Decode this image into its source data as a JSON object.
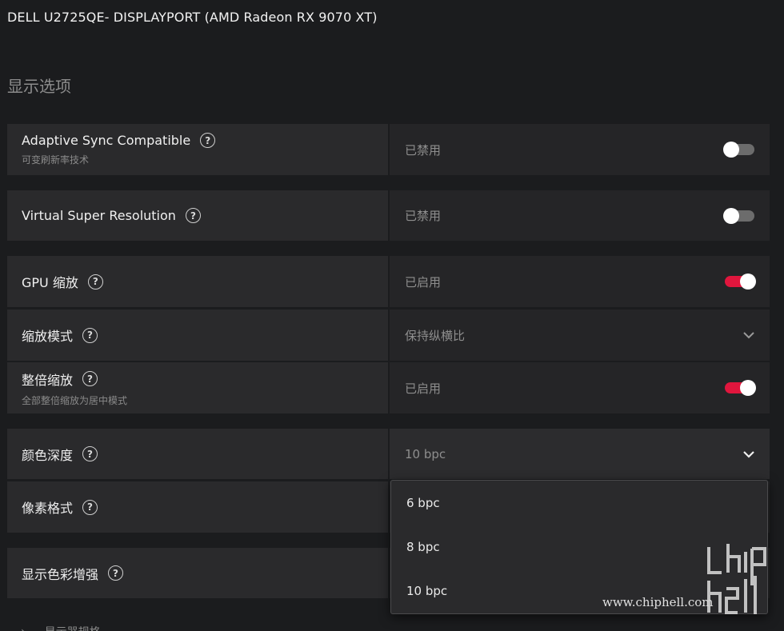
{
  "header": {
    "title": "DELL U2725QE- DISPLAYPORT (AMD Radeon RX 9070 XT)"
  },
  "section": {
    "title": "显示选项"
  },
  "settings": {
    "adaptive_sync": {
      "label": "Adaptive Sync Compatible",
      "sub": "可变刷新率技术",
      "value": "已禁用",
      "state": "off"
    },
    "vsr": {
      "label": "Virtual Super Resolution",
      "value": "已禁用",
      "state": "off"
    },
    "gpu_scaling": {
      "label": "GPU 缩放",
      "value": "已启用",
      "state": "on"
    },
    "scaling_mode": {
      "label": "缩放模式",
      "value": "保持纵横比"
    },
    "integer_scaling": {
      "label": "整倍缩放",
      "sub": "全部整倍缩放为居中模式",
      "value": "已启用",
      "state": "on"
    },
    "color_depth": {
      "label": "颜色深度",
      "value": "10 bpc"
    },
    "pixel_format": {
      "label": "像素格式"
    },
    "color_enhance": {
      "label": "显示色彩增强"
    }
  },
  "color_depth_dropdown": {
    "options": [
      "6 bpc",
      "8 bpc",
      "10 bpc"
    ]
  },
  "footer": {
    "cutoff_text": "显示器规格"
  },
  "watermark": {
    "text": "www.chiphell.com"
  },
  "colors": {
    "accent": "#e0163d",
    "background": "#1b1c1e",
    "panel": "#2a2a2c"
  },
  "icons": {
    "help": "question-circle-icon",
    "chevron": "chevron-down-icon"
  }
}
